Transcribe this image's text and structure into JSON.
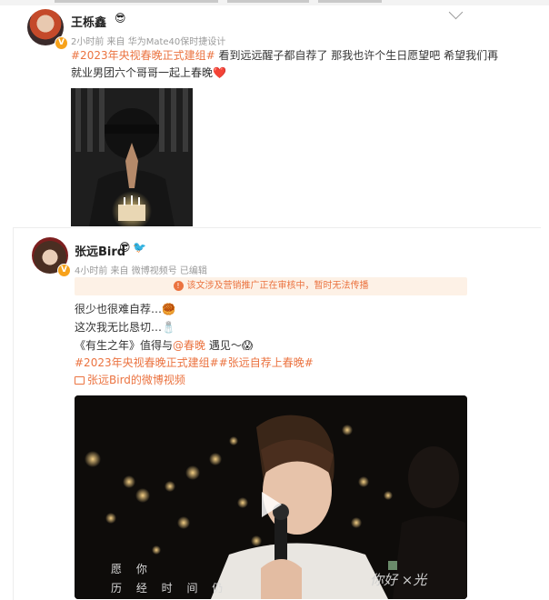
{
  "post1": {
    "author": "王栎鑫",
    "author_badge_icon": "smiley-badge-icon",
    "meta": "2小时前  来自 华为Mate40保时捷设计",
    "hashtag": "#2023年央视春晚正式建组#",
    "text_line1": " 看到远远醒子都自荐了 那我也许个生日愿望吧 希望我们再",
    "text_line2": "就业男团六个哥哥一起上春晚",
    "heart_emoji": "❤️"
  },
  "post2": {
    "author": "张远Bird",
    "badge_icons": [
      "smiley-badge-icon",
      "bird-badge-icon"
    ],
    "meta": "4小时前  来自 微博视频号  已编辑",
    "notice": "该文涉及营销推广正在审核中，暂时无法传播",
    "line1": "很少也很难自荐…",
    "line1_emoji": "🥮",
    "line2": "这次我无比恳切…",
    "line2_emoji": "🧂",
    "line3_prefix": "《有生之年》值得与",
    "line3_mention": "@春晚",
    "line3_suffix": " 遇见～",
    "line3_emoji": "😱",
    "hashtags": "#2023年央视春晚正式建组##张远自荐上春晚#",
    "video_link_icon": "video-link-icon",
    "video_link": "张远Bird的微博视频",
    "video": {
      "subtitle_line1": "愿 你",
      "subtitle_line2": "历 经 时 间 仍",
      "watermark": "你好 ×光"
    }
  }
}
